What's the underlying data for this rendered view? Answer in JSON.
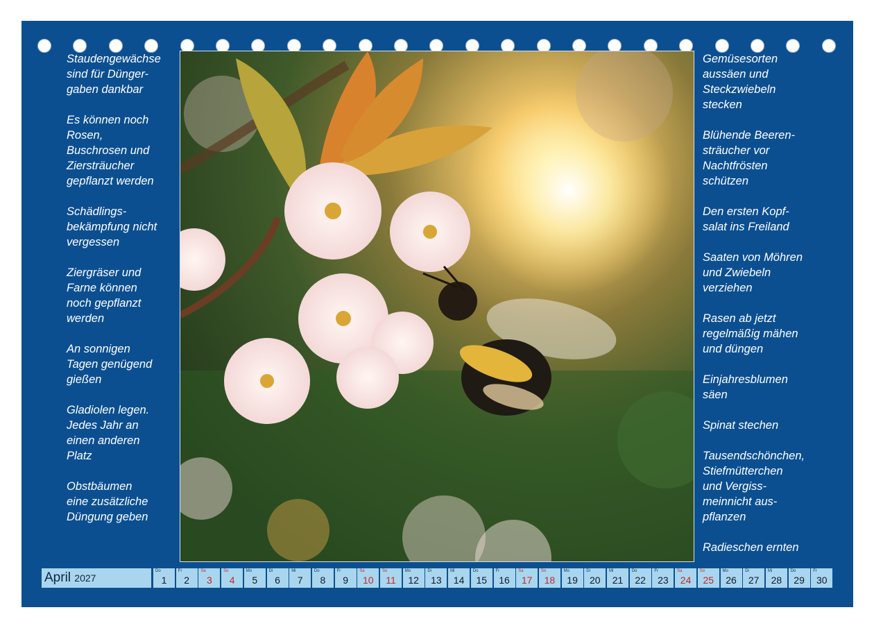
{
  "calendar": {
    "month": "April",
    "year": "2027",
    "weekend_color": "#c0282b",
    "panel_color": "#0c4f91",
    "days": [
      {
        "wd": "Do",
        "d": "1",
        "we": false
      },
      {
        "wd": "Fr",
        "d": "2",
        "we": false
      },
      {
        "wd": "Sa",
        "d": "3",
        "we": true
      },
      {
        "wd": "So",
        "d": "4",
        "we": true
      },
      {
        "wd": "Mo",
        "d": "5",
        "we": false
      },
      {
        "wd": "Di",
        "d": "6",
        "we": false
      },
      {
        "wd": "Mi",
        "d": "7",
        "we": false
      },
      {
        "wd": "Do",
        "d": "8",
        "we": false
      },
      {
        "wd": "Fr",
        "d": "9",
        "we": false
      },
      {
        "wd": "Sa",
        "d": "10",
        "we": true
      },
      {
        "wd": "So",
        "d": "11",
        "we": true
      },
      {
        "wd": "Mo",
        "d": "12",
        "we": false
      },
      {
        "wd": "Di",
        "d": "13",
        "we": false
      },
      {
        "wd": "Mi",
        "d": "14",
        "we": false
      },
      {
        "wd": "Do",
        "d": "15",
        "we": false
      },
      {
        "wd": "Fr",
        "d": "16",
        "we": false
      },
      {
        "wd": "Sa",
        "d": "17",
        "we": true
      },
      {
        "wd": "So",
        "d": "18",
        "we": true
      },
      {
        "wd": "Mo",
        "d": "19",
        "we": false
      },
      {
        "wd": "Di",
        "d": "20",
        "we": false
      },
      {
        "wd": "Mi",
        "d": "21",
        "we": false
      },
      {
        "wd": "Do",
        "d": "22",
        "we": false
      },
      {
        "wd": "Fr",
        "d": "23",
        "we": false
      },
      {
        "wd": "Sa",
        "d": "24",
        "we": true
      },
      {
        "wd": "So",
        "d": "25",
        "we": true
      },
      {
        "wd": "Mo",
        "d": "26",
        "we": false
      },
      {
        "wd": "Di",
        "d": "27",
        "we": false
      },
      {
        "wd": "Mi",
        "d": "28",
        "we": false
      },
      {
        "wd": "Do",
        "d": "29",
        "we": false
      },
      {
        "wd": "Fr",
        "d": "30",
        "we": false
      }
    ]
  },
  "tips_left": [
    "Staudengewächse\nsind für Dünger-\ngaben dankbar",
    "Es können noch\nRosen,\nBuschrosen und\nZiersträucher\ngepflanzt werden",
    "Schädlings-\nbekämpfung nicht\nvergessen",
    "Ziergräser und\nFarne können\nnoch gepflanzt\nwerden",
    "An sonnigen\nTagen genügend\ngießen",
    "Gladiolen legen.\nJedes Jahr an\neinen anderen\nPlatz",
    "Obstbäumen\neine zusätzliche\nDüngung geben"
  ],
  "tips_right": [
    "Gemüsesorten\naussäen und\nSteckzwiebeln\nstecken",
    "Blühende Beeren-\nsträucher vor\nNachtfrösten\nschützen",
    "Den ersten Kopf-\nsalat ins Freiland",
    "Saaten von Möhren\nund Zwiebeln\nverziehen",
    "Rasen ab jetzt\nregelmäßig mähen\nund düngen",
    "Einjahresblumen\nsäen",
    "Spinat stechen",
    "Tausendschönchen,\nStiefmütterchen\nund Vergiss-\nmeinnicht aus-\npflanzen",
    "Radieschen ernten"
  ]
}
